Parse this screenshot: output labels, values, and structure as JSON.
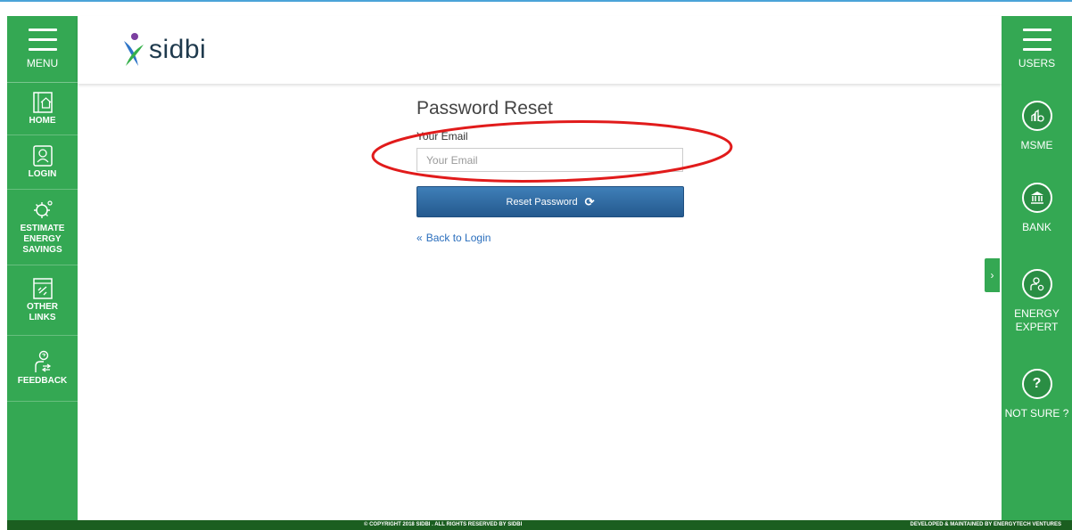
{
  "left_sidebar": {
    "menu_label": "MENU",
    "items": [
      {
        "label": "HOME",
        "icon": "home-building-icon"
      },
      {
        "label": "LOGIN",
        "icon": "login-user-icon"
      },
      {
        "label": "ESTIMATE\nENERGY\nSAVINGS",
        "icon": "energy-savings-icon"
      },
      {
        "label": "OTHER\nLINKS",
        "icon": "links-icon"
      },
      {
        "label": "FEEDBACK",
        "icon": "feedback-icon"
      }
    ]
  },
  "header": {
    "logo_text": "sidbi"
  },
  "form": {
    "title": "Password Reset",
    "email_label": "Your Email",
    "email_placeholder": "Your Email",
    "email_value": "",
    "reset_button": "Reset Password",
    "back_link": "Back to Login"
  },
  "right_sidebar": {
    "users_label": "USERS",
    "items": [
      {
        "label": "MSME",
        "icon": "msme-icon"
      },
      {
        "label": "BANK",
        "icon": "bank-icon"
      },
      {
        "label": "ENERGY\nEXPERT",
        "icon": "energy-expert-icon"
      },
      {
        "label": "NOT SURE ?",
        "icon": "question-icon"
      }
    ]
  },
  "footer": {
    "copyright": "© COPYRIGHT 2018 SIDBI . ALL RIGHTS RESERVED BY SIDBI",
    "developer": "DEVELOPED & MAINTAINED BY ENERGYTECH VENTURES"
  },
  "colors": {
    "sidebar_green": "#34a853",
    "footer_green": "#1b5e20",
    "button_blue": "#2f6aa3",
    "link_blue": "#2a6ebd",
    "highlight_red": "#e11b1b"
  }
}
